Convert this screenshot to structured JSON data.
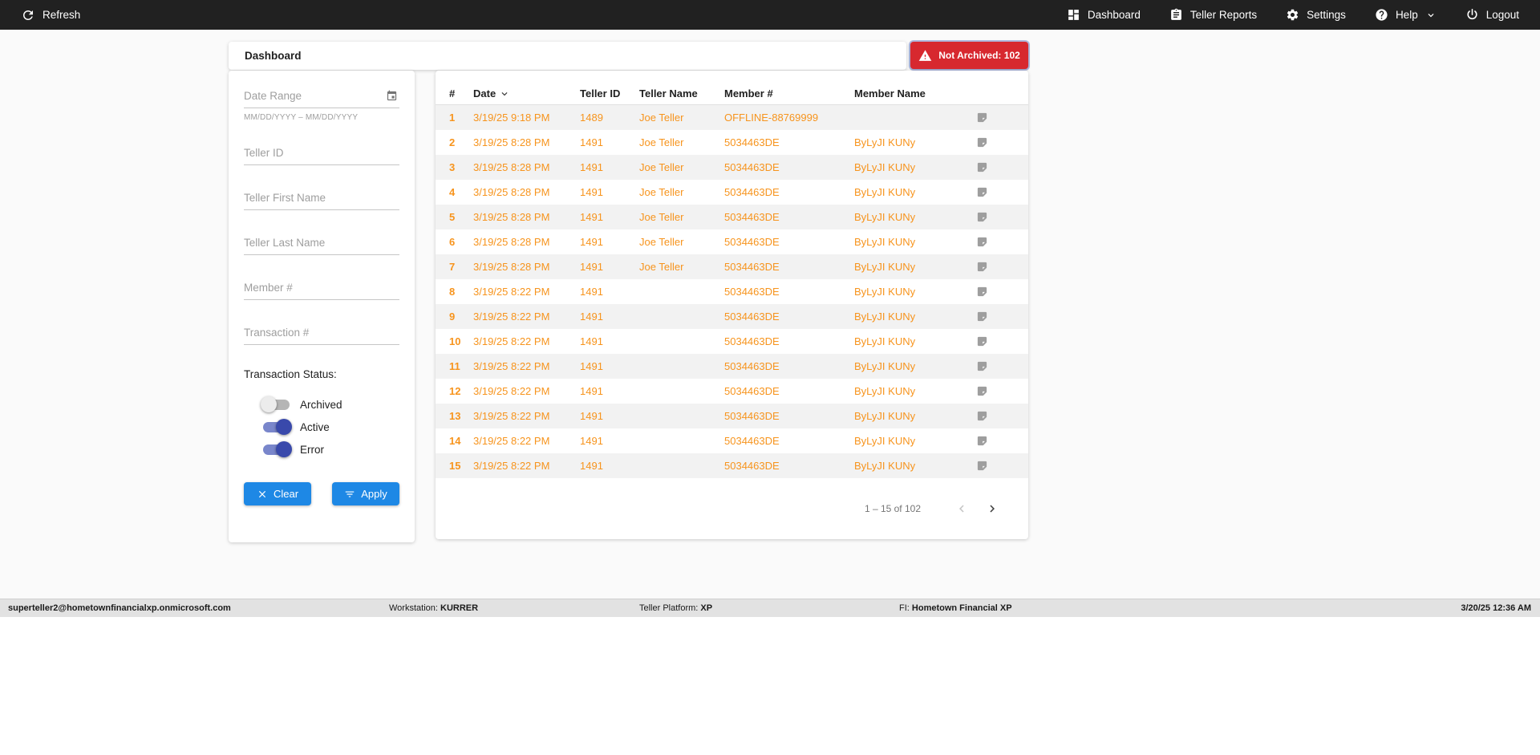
{
  "colors": {
    "accent_orange": "#f7941d",
    "accent_blue": "#1e88e5",
    "badge_red": "#d7282f",
    "toggle_on_track": "#7986cb",
    "toggle_on_knob": "#3949ab",
    "navbar_bg": "#212121"
  },
  "navbar": {
    "refresh_label": "Refresh",
    "dashboard_label": "Dashboard",
    "teller_reports_label": "Teller Reports",
    "settings_label": "Settings",
    "help_label": "Help",
    "logout_label": "Logout"
  },
  "header": {
    "title": "Dashboard",
    "not_archived_label": "Not Archived: 102"
  },
  "filters": {
    "date_range_placeholder": "Date Range",
    "date_range_hint": "MM/DD/YYYY – MM/DD/YYYY",
    "teller_id_placeholder": "Teller ID",
    "teller_first_name_placeholder": "Teller First Name",
    "teller_last_name_placeholder": "Teller Last Name",
    "member_placeholder": "Member #",
    "transaction_placeholder": "Transaction #",
    "status_label": "Transaction Status:",
    "toggles": [
      {
        "label": "Archived",
        "on": false
      },
      {
        "label": "Active",
        "on": true
      },
      {
        "label": "Error",
        "on": true
      }
    ],
    "clear_label": "Clear",
    "apply_label": "Apply"
  },
  "table": {
    "columns": [
      "#",
      "Date",
      "Teller ID",
      "Teller Name",
      "Member #",
      "Member Name"
    ],
    "rows": [
      {
        "num": "1",
        "date": "3/19/25 9:18 PM",
        "teller_id": "1489",
        "teller_name": "Joe Teller",
        "member": "OFFLINE-88769999",
        "member_name": ""
      },
      {
        "num": "2",
        "date": "3/19/25 8:28 PM",
        "teller_id": "1491",
        "teller_name": "Joe Teller",
        "member": "5034463DE",
        "member_name": "ByLyJI KUNy"
      },
      {
        "num": "3",
        "date": "3/19/25 8:28 PM",
        "teller_id": "1491",
        "teller_name": "Joe Teller",
        "member": "5034463DE",
        "member_name": "ByLyJI KUNy"
      },
      {
        "num": "4",
        "date": "3/19/25 8:28 PM",
        "teller_id": "1491",
        "teller_name": "Joe Teller",
        "member": "5034463DE",
        "member_name": "ByLyJI KUNy"
      },
      {
        "num": "5",
        "date": "3/19/25 8:28 PM",
        "teller_id": "1491",
        "teller_name": "Joe Teller",
        "member": "5034463DE",
        "member_name": "ByLyJI KUNy"
      },
      {
        "num": "6",
        "date": "3/19/25 8:28 PM",
        "teller_id": "1491",
        "teller_name": "Joe Teller",
        "member": "5034463DE",
        "member_name": "ByLyJI KUNy"
      },
      {
        "num": "7",
        "date": "3/19/25 8:28 PM",
        "teller_id": "1491",
        "teller_name": "Joe Teller",
        "member": "5034463DE",
        "member_name": "ByLyJI KUNy"
      },
      {
        "num": "8",
        "date": "3/19/25 8:22 PM",
        "teller_id": "1491",
        "teller_name": "",
        "member": "5034463DE",
        "member_name": "ByLyJI KUNy"
      },
      {
        "num": "9",
        "date": "3/19/25 8:22 PM",
        "teller_id": "1491",
        "teller_name": "",
        "member": "5034463DE",
        "member_name": "ByLyJI KUNy"
      },
      {
        "num": "10",
        "date": "3/19/25 8:22 PM",
        "teller_id": "1491",
        "teller_name": "",
        "member": "5034463DE",
        "member_name": "ByLyJI KUNy"
      },
      {
        "num": "11",
        "date": "3/19/25 8:22 PM",
        "teller_id": "1491",
        "teller_name": "",
        "member": "5034463DE",
        "member_name": "ByLyJI KUNy"
      },
      {
        "num": "12",
        "date": "3/19/25 8:22 PM",
        "teller_id": "1491",
        "teller_name": "",
        "member": "5034463DE",
        "member_name": "ByLyJI KUNy"
      },
      {
        "num": "13",
        "date": "3/19/25 8:22 PM",
        "teller_id": "1491",
        "teller_name": "",
        "member": "5034463DE",
        "member_name": "ByLyJI KUNy"
      },
      {
        "num": "14",
        "date": "3/19/25 8:22 PM",
        "teller_id": "1491",
        "teller_name": "",
        "member": "5034463DE",
        "member_name": "ByLyJI KUNy"
      },
      {
        "num": "15",
        "date": "3/19/25 8:22 PM",
        "teller_id": "1491",
        "teller_name": "",
        "member": "5034463DE",
        "member_name": "ByLyJI KUNy"
      }
    ],
    "pagination_label": "1 – 15 of 102"
  },
  "footer": {
    "user": "superteller2@hometownfinancialxp.onmicrosoft.com",
    "workstation_label": "Workstation:",
    "workstation_value": "KURRER",
    "platform_label": "Teller Platform:",
    "platform_value": "XP",
    "fi_label": "FI:",
    "fi_value": "Hometown Financial XP",
    "datetime": "3/20/25 12:36 AM"
  }
}
